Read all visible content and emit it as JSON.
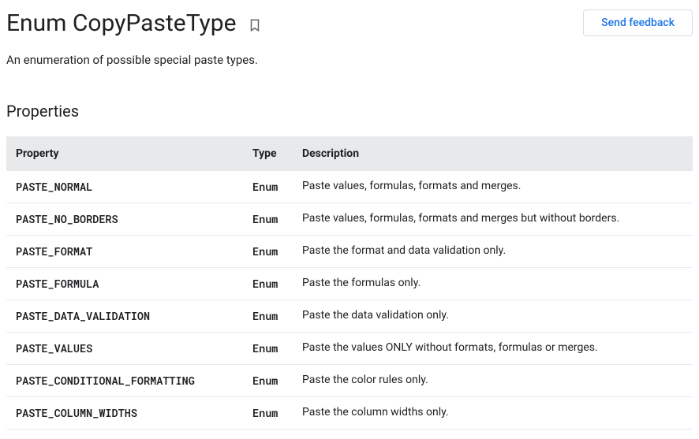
{
  "page": {
    "title": "Enum CopyPasteType",
    "feedback_label": "Send feedback",
    "description": "An enumeration of possible special paste types.",
    "section_heading": "Properties"
  },
  "table": {
    "headers": {
      "property": "Property",
      "type": "Type",
      "description": "Description"
    },
    "rows": [
      {
        "property": "PASTE_NORMAL",
        "type": "Enum",
        "description": "Paste values, formulas, formats and merges."
      },
      {
        "property": "PASTE_NO_BORDERS",
        "type": "Enum",
        "description": "Paste values, formulas, formats and merges but without borders."
      },
      {
        "property": "PASTE_FORMAT",
        "type": "Enum",
        "description": "Paste the format and data validation only."
      },
      {
        "property": "PASTE_FORMULA",
        "type": "Enum",
        "description": "Paste the formulas only."
      },
      {
        "property": "PASTE_DATA_VALIDATION",
        "type": "Enum",
        "description": "Paste the data validation only."
      },
      {
        "property": "PASTE_VALUES",
        "type": "Enum",
        "description": "Paste the values ONLY without formats, formulas or merges."
      },
      {
        "property": "PASTE_CONDITIONAL_FORMATTING",
        "type": "Enum",
        "description": "Paste the color rules only."
      },
      {
        "property": "PASTE_COLUMN_WIDTHS",
        "type": "Enum",
        "description": "Paste the column widths only."
      }
    ]
  }
}
